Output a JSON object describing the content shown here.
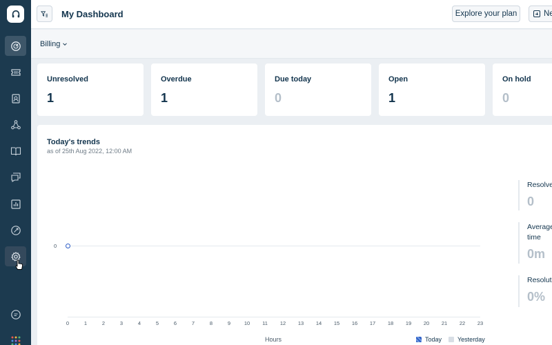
{
  "header": {
    "title": "My Dashboard",
    "explore_label": "Explore your plan",
    "new_label": "Ne"
  },
  "filter": {
    "group": "Billing"
  },
  "cards": [
    {
      "label": "Unresolved",
      "value": "1"
    },
    {
      "label": "Overdue",
      "value": "1"
    },
    {
      "label": "Due today",
      "value": "0"
    },
    {
      "label": "Open",
      "value": "1"
    },
    {
      "label": "On hold",
      "value": "0"
    }
  ],
  "trends": {
    "title": "Today's trends",
    "subtitle": "as of 25th Aug 2022, 12:00 AM",
    "legend": {
      "today": "Today",
      "yesterday": "Yesterday"
    },
    "metrics": [
      {
        "label": "Resolve",
        "value": "0"
      },
      {
        "label": "Average time",
        "value": "0m"
      },
      {
        "label": "Resolutio",
        "value": "0%"
      }
    ]
  },
  "chart_data": {
    "type": "line",
    "title": "",
    "xlabel": "Hours",
    "ylabel": "",
    "x": [
      0,
      1,
      2,
      3,
      4,
      5,
      6,
      7,
      8,
      9,
      10,
      11,
      12,
      13,
      14,
      15,
      16,
      17,
      18,
      19,
      20,
      21,
      22,
      23
    ],
    "y_ticks": [
      "0"
    ],
    "series": [
      {
        "name": "Today",
        "values": [
          0
        ]
      },
      {
        "name": "Yesterday",
        "values": []
      }
    ],
    "legend_position": "bottom-right",
    "grid": false
  },
  "colors": {
    "sidebar": "#1c3a4f",
    "accent": "#2c5cc5",
    "text": "#12344d",
    "muted_value": "#b4bfc9"
  },
  "icons": {
    "sidebar": [
      "dashboard-icon",
      "tickets-icon",
      "contacts-icon",
      "groups-icon",
      "solutions-icon",
      "forums-icon",
      "reports-icon",
      "admin-icon",
      "settings-icon",
      "chat-icon",
      "apps-icon"
    ]
  }
}
